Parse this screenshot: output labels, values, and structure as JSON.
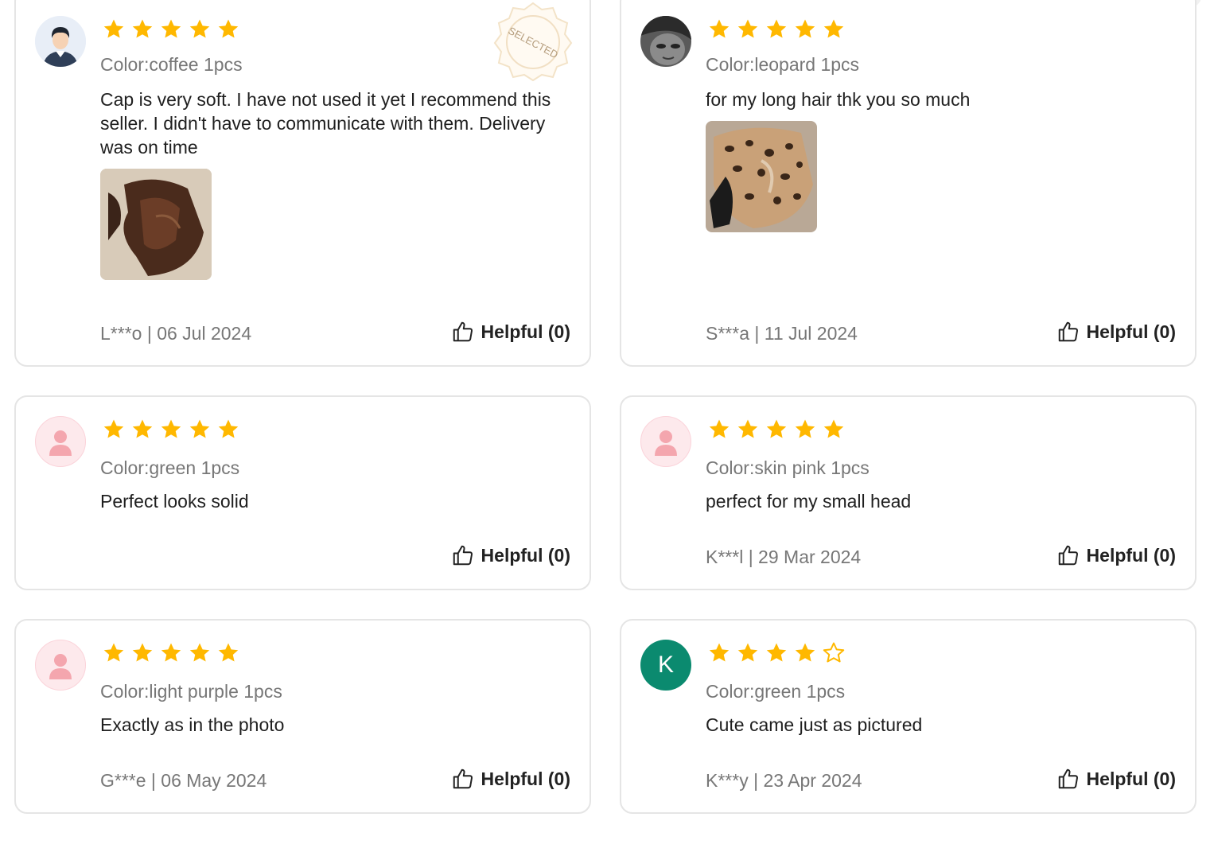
{
  "colors": {
    "star": "#FFB800",
    "star_empty_stroke": "#FFB800",
    "k_avatar_bg": "#0b8a6f"
  },
  "reviews": [
    {
      "stars": 5,
      "color": "Color:coffee 1pcs",
      "text": "Cap is very soft. I have not used it yet I recommend this seller. I didn't have to communicate with them. Delivery was on time",
      "author_date": "L***o | 06 Jul 2024",
      "helpful": "Helpful (0)",
      "avatar": "man-avatar-icon",
      "stamp": "SELECTED",
      "has_photo": true
    },
    {
      "stars": 5,
      "color": "Color:leopard 1pcs",
      "text": "for my long hair thk you so much",
      "author_date": "S***a | 11 Jul 2024",
      "helpful": "Helpful (0)",
      "avatar": "user-photo-avatar",
      "has_photo": true
    },
    {
      "stars": 5,
      "color": "Color:green 1pcs",
      "text": "Perfect looks solid",
      "author_date": "",
      "helpful": "Helpful (0)",
      "avatar": "default-user-icon"
    },
    {
      "stars": 5,
      "color": "Color:skin pink 1pcs",
      "text": "perfect for my small head",
      "author_date": "K***l | 29 Mar 2024",
      "helpful": "Helpful (0)",
      "avatar": "default-user-icon"
    },
    {
      "stars": 5,
      "color": "Color:light purple 1pcs",
      "text": "Exactly as in the photo",
      "author_date": "G***e | 06 May 2024",
      "helpful": "Helpful (0)",
      "avatar": "default-user-icon"
    },
    {
      "stars": 4,
      "color": "Color:green 1pcs",
      "text": "Cute came just as pictured",
      "author_date": "K***y | 23 Apr 2024",
      "helpful": "Helpful (0)",
      "avatar": "letter-avatar",
      "avatar_letter": "K"
    }
  ]
}
